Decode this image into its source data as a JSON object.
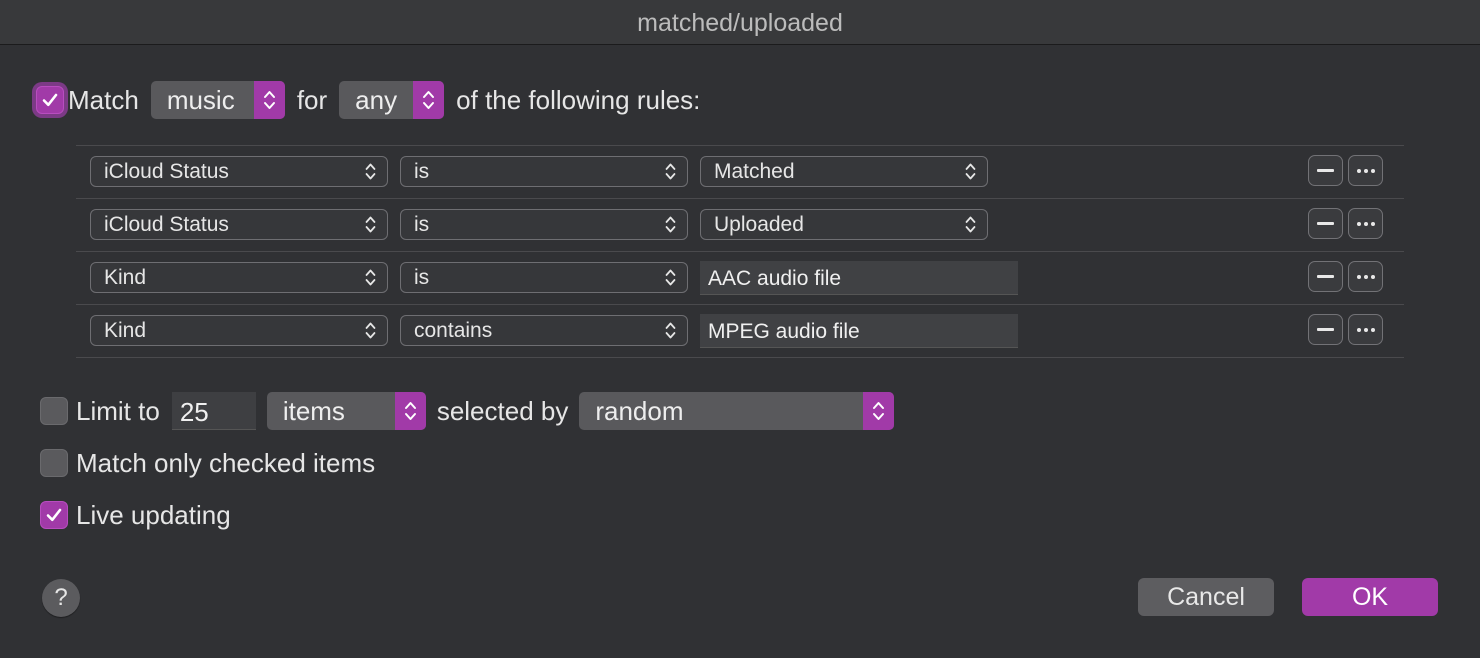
{
  "window": {
    "title": "matched/uploaded"
  },
  "match_row": {
    "checked": true,
    "label_match": "Match",
    "media_value": "music",
    "label_for": "for",
    "any_value": "any",
    "label_rules": "of the following rules:"
  },
  "rules": [
    {
      "field": "iCloud Status",
      "operator": "is",
      "value": "Matched",
      "value_type": "popup"
    },
    {
      "field": "iCloud Status",
      "operator": "is",
      "value": "Uploaded",
      "value_type": "popup"
    },
    {
      "field": "Kind",
      "operator": "is",
      "value": "AAC audio file",
      "value_type": "text"
    },
    {
      "field": "Kind",
      "operator": "contains",
      "value": "MPEG audio file",
      "value_type": "text"
    }
  ],
  "limit": {
    "checked": false,
    "label": "Limit to",
    "value": "25",
    "unit": "items",
    "selected_by_label": "selected by",
    "selected_by_value": "random"
  },
  "match_checked": {
    "checked": false,
    "label": "Match only checked items"
  },
  "live_updating": {
    "checked": true,
    "label": "Live updating"
  },
  "footer": {
    "help": "?",
    "cancel": "Cancel",
    "ok": "OK"
  },
  "colors": {
    "accent": "#a13aa8",
    "background": "#303134",
    "titlebar": "#38393b"
  }
}
